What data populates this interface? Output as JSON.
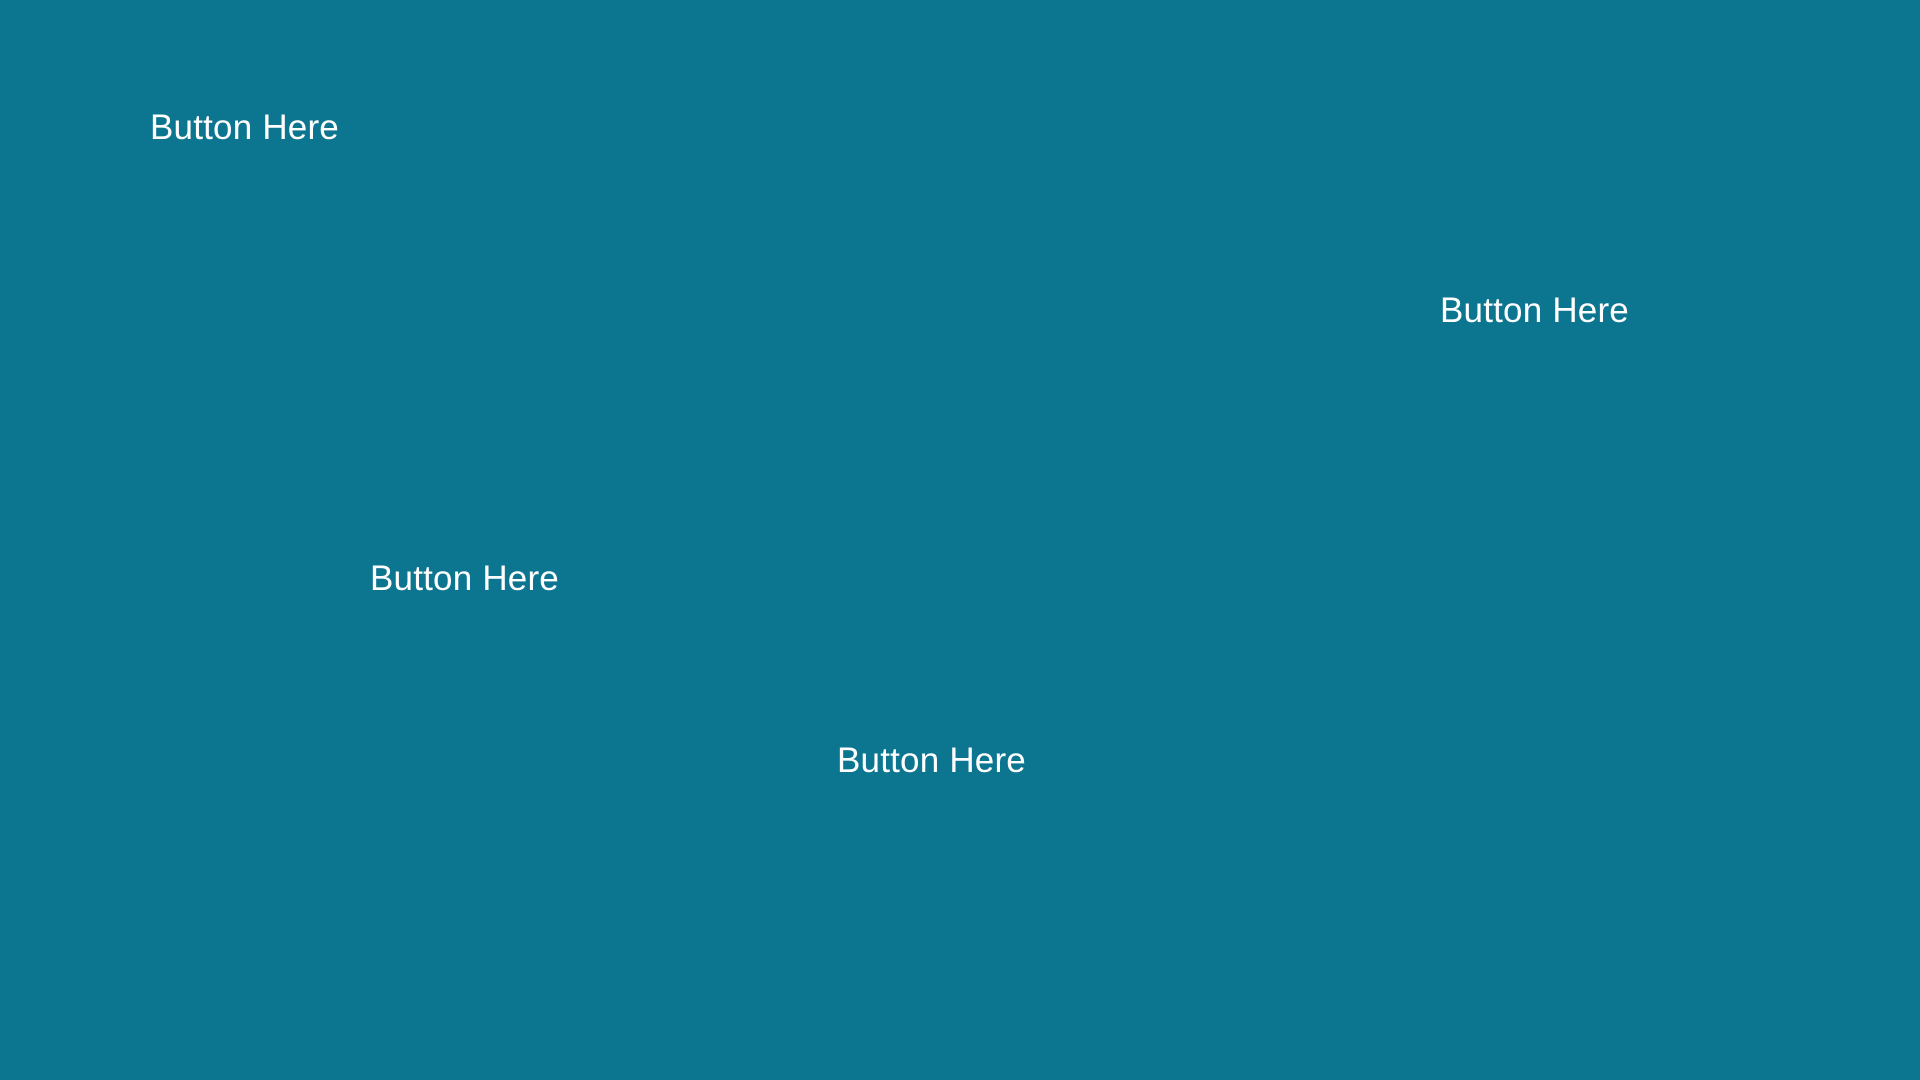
{
  "theme": {
    "background": "#0C758F",
    "text_color": "#FFFFFF"
  },
  "buttons": [
    {
      "label": "Button Here"
    },
    {
      "label": "Button Here"
    },
    {
      "label": "Button Here"
    },
    {
      "label": "Button Here"
    }
  ]
}
